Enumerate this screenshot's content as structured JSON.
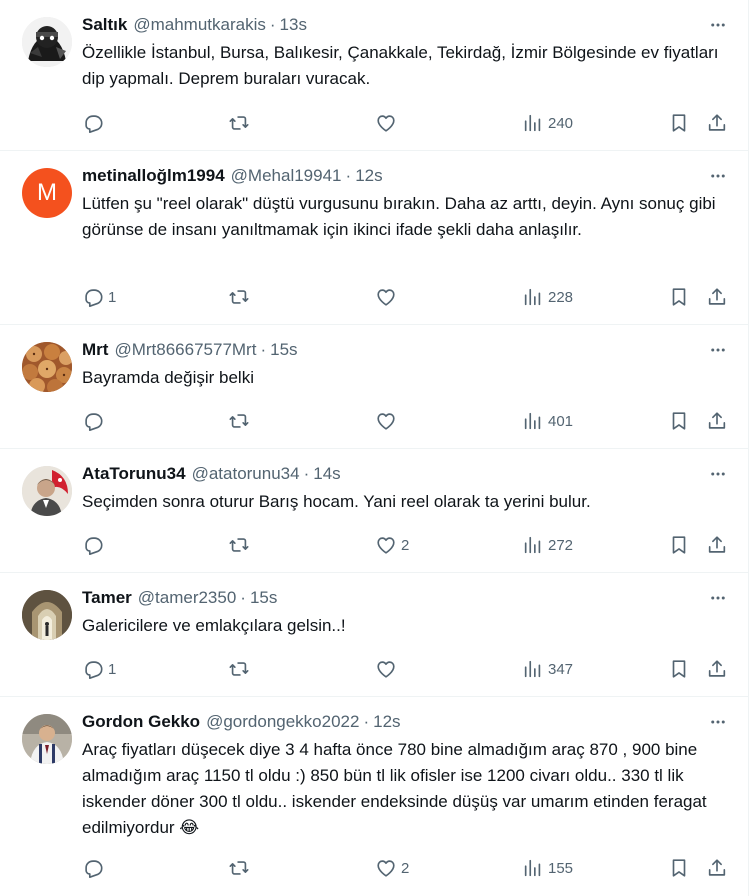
{
  "tweets": [
    {
      "name": "Saltık",
      "handle": "@mahmutkarakis",
      "time": "13s",
      "text": "Özellikle İstanbul, Bursa, Balıkesir, Çanakkale, Tekirdağ, İzmir Bölgesinde ev fiyatları dip yapmalı. Deprem buraları vuracak.",
      "replies": "",
      "likes": "",
      "views": "240",
      "avatar": "dark-character-avatar"
    },
    {
      "name": "metinalloğlm1994",
      "handle": "@Mehal19941",
      "time": "12s",
      "text": "Lütfen şu \"reel olarak\" düştü vurgusunu bırakın. Daha az arttı, deyin. Aynı sonuç gibi görünse de insanı yanıltmamak için ikinci ifade şekli daha anlaşılır.",
      "replies": "1",
      "likes": "",
      "views": "228",
      "avatar_letter": "M",
      "avatar_color": "#f4511e"
    },
    {
      "name": "Mrt",
      "handle": "@Mrt86667577Mrt",
      "time": "15s",
      "text": "Bayramda değişir belki",
      "replies": "",
      "likes": "",
      "views": "401",
      "avatar": "pastry-photo-avatar"
    },
    {
      "name": "AtaTorunu34",
      "handle": "@atatorunu34",
      "time": "14s",
      "text": "Seçimden sonra oturur Barış hocam. Yani reel olarak ta yerini bulur.",
      "replies": "",
      "likes": "2",
      "views": "272",
      "avatar": "portrait-flag-avatar"
    },
    {
      "name": "Tamer",
      "handle": "@tamer2350",
      "time": "15s",
      "text": "Galericilere ve emlakçılara gelsin..!",
      "replies": "1",
      "likes": "",
      "views": "347",
      "avatar": "archway-photo-avatar"
    },
    {
      "name": "Gordon Gekko",
      "handle": "@gordongekko2022",
      "time": "12s",
      "text": "Araç fiyatları düşecek diye 3 4 hafta önce 780 bine almadığım araç 870 , 900 bine almadığım araç 1150 tl oldu :) 850 bün tl lik ofisler ise 1200 civarı oldu.. 330 tl lik iskender döner 300 tl oldu.. iskender endeksinde düşüş var umarım etinden feragat edilmiyordur 😂",
      "replies": "",
      "likes": "2",
      "views": "155",
      "avatar": "man-suspenders-avatar"
    }
  ],
  "colors": {
    "text": "#0f1419",
    "secondary": "#536471",
    "border": "#eff3f4"
  }
}
